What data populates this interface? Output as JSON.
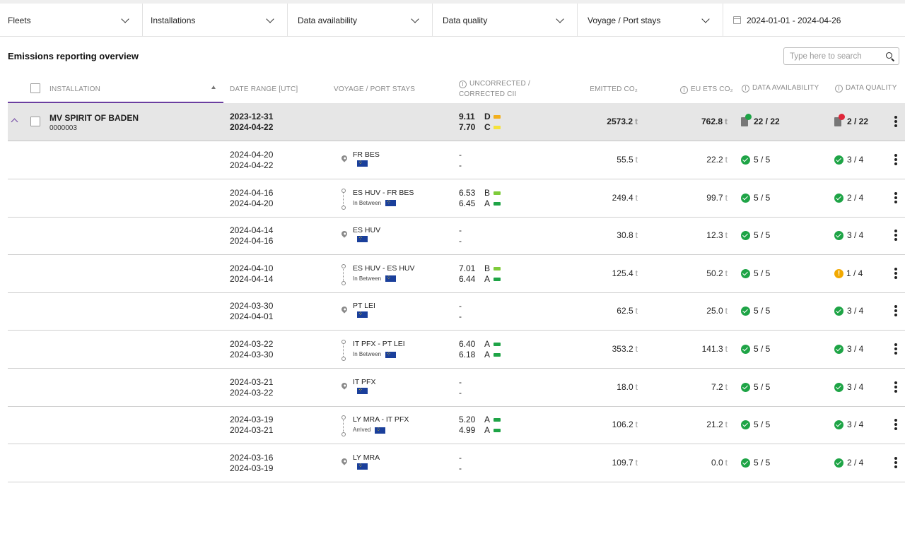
{
  "filters": {
    "fleets": "Fleets",
    "installations": "Installations",
    "availability": "Data availability",
    "quality": "Data quality",
    "voyage": "Voyage / Port stays",
    "date_range": "2024-01-01 - 2024-04-26"
  },
  "page_title": "Emissions reporting overview",
  "search": {
    "placeholder": "Type here to search"
  },
  "columns": {
    "installation": "Installation",
    "date_range": "Date range [UTC]",
    "voyage": "Voyage / Port stays",
    "cii_1": "Uncorrected /",
    "cii_2": "Corrected CII",
    "emitted": "Emitted CO₂",
    "euets": "EU ETS CO₂",
    "availability": "Data availability",
    "quality": "Data quality"
  },
  "colors": {
    "accent": "#6b3fa0",
    "ok": "#1ea446",
    "warn": "#f2a900",
    "err": "#e0263a",
    "grade_A": "#1ea446",
    "grade_B": "#7ecb3a",
    "grade_C": "#f5e23a",
    "grade_D": "#f2b01e"
  },
  "summary": {
    "name": "MV SPIRIT OF BADEN",
    "id": "0000003",
    "date_from": "2023-12-31",
    "date_to": "2024-04-22",
    "cii_uncorrected": "9.11",
    "grade_uncorrected": "D",
    "cii_corrected": "7.70",
    "grade_corrected": "C",
    "emitted": "2573.2",
    "euets": "762.8",
    "unit": "t",
    "availability": "22 / 22",
    "quality": "2 / 22"
  },
  "rows": [
    {
      "date_from": "2024-04-20",
      "date_to": "2024-04-22",
      "type": "port",
      "name": "FR BES",
      "status": "",
      "cii_u": "-",
      "grade_u": "",
      "cii_c": "-",
      "grade_c": "",
      "emitted": "55.5",
      "euets": "22.2",
      "unit": "t",
      "availability": "5 / 5",
      "quality": "3 / 4",
      "quality_status": "ok"
    },
    {
      "date_from": "2024-04-16",
      "date_to": "2024-04-20",
      "type": "voyage",
      "name": "ES HUV - FR BES",
      "status": "In Between",
      "cii_u": "6.53",
      "grade_u": "B",
      "cii_c": "6.45",
      "grade_c": "A",
      "emitted": "249.4",
      "euets": "99.7",
      "unit": "t",
      "availability": "5 / 5",
      "quality": "2 / 4",
      "quality_status": "ok"
    },
    {
      "date_from": "2024-04-14",
      "date_to": "2024-04-16",
      "type": "port",
      "name": "ES HUV",
      "status": "",
      "cii_u": "-",
      "grade_u": "",
      "cii_c": "-",
      "grade_c": "",
      "emitted": "30.8",
      "euets": "12.3",
      "unit": "t",
      "availability": "5 / 5",
      "quality": "3 / 4",
      "quality_status": "ok"
    },
    {
      "date_from": "2024-04-10",
      "date_to": "2024-04-14",
      "type": "voyage",
      "name": "ES HUV - ES HUV",
      "status": "In Between",
      "cii_u": "7.01",
      "grade_u": "B",
      "cii_c": "6.44",
      "grade_c": "A",
      "emitted": "125.4",
      "euets": "50.2",
      "unit": "t",
      "availability": "5 / 5",
      "quality": "1 / 4",
      "quality_status": "warn"
    },
    {
      "date_from": "2024-03-30",
      "date_to": "2024-04-01",
      "type": "port",
      "name": "PT LEI",
      "status": "",
      "cii_u": "-",
      "grade_u": "",
      "cii_c": "-",
      "grade_c": "",
      "emitted": "62.5",
      "euets": "25.0",
      "unit": "t",
      "availability": "5 / 5",
      "quality": "3 / 4",
      "quality_status": "ok"
    },
    {
      "date_from": "2024-03-22",
      "date_to": "2024-03-30",
      "type": "voyage",
      "name": "IT PFX - PT LEI",
      "status": "In Between",
      "cii_u": "6.40",
      "grade_u": "A",
      "cii_c": "6.18",
      "grade_c": "A",
      "emitted": "353.2",
      "euets": "141.3",
      "unit": "t",
      "availability": "5 / 5",
      "quality": "3 / 4",
      "quality_status": "ok"
    },
    {
      "date_from": "2024-03-21",
      "date_to": "2024-03-22",
      "type": "port",
      "name": "IT PFX",
      "status": "",
      "cii_u": "-",
      "grade_u": "",
      "cii_c": "-",
      "grade_c": "",
      "emitted": "18.0",
      "euets": "7.2",
      "unit": "t",
      "availability": "5 / 5",
      "quality": "3 / 4",
      "quality_status": "ok"
    },
    {
      "date_from": "2024-03-19",
      "date_to": "2024-03-21",
      "type": "voyage",
      "name": "LY MRA - IT PFX",
      "status": "Arrived",
      "cii_u": "5.20",
      "grade_u": "A",
      "cii_c": "4.99",
      "grade_c": "A",
      "emitted": "106.2",
      "euets": "21.2",
      "unit": "t",
      "availability": "5 / 5",
      "quality": "3 / 4",
      "quality_status": "ok"
    },
    {
      "date_from": "2024-03-16",
      "date_to": "2024-03-19",
      "type": "port",
      "name": "LY MRA",
      "status": "",
      "cii_u": "-",
      "grade_u": "",
      "cii_c": "-",
      "grade_c": "",
      "emitted": "109.7",
      "euets": "0.0",
      "unit": "t",
      "availability": "5 / 5",
      "quality": "2 / 4",
      "quality_status": "ok"
    }
  ]
}
